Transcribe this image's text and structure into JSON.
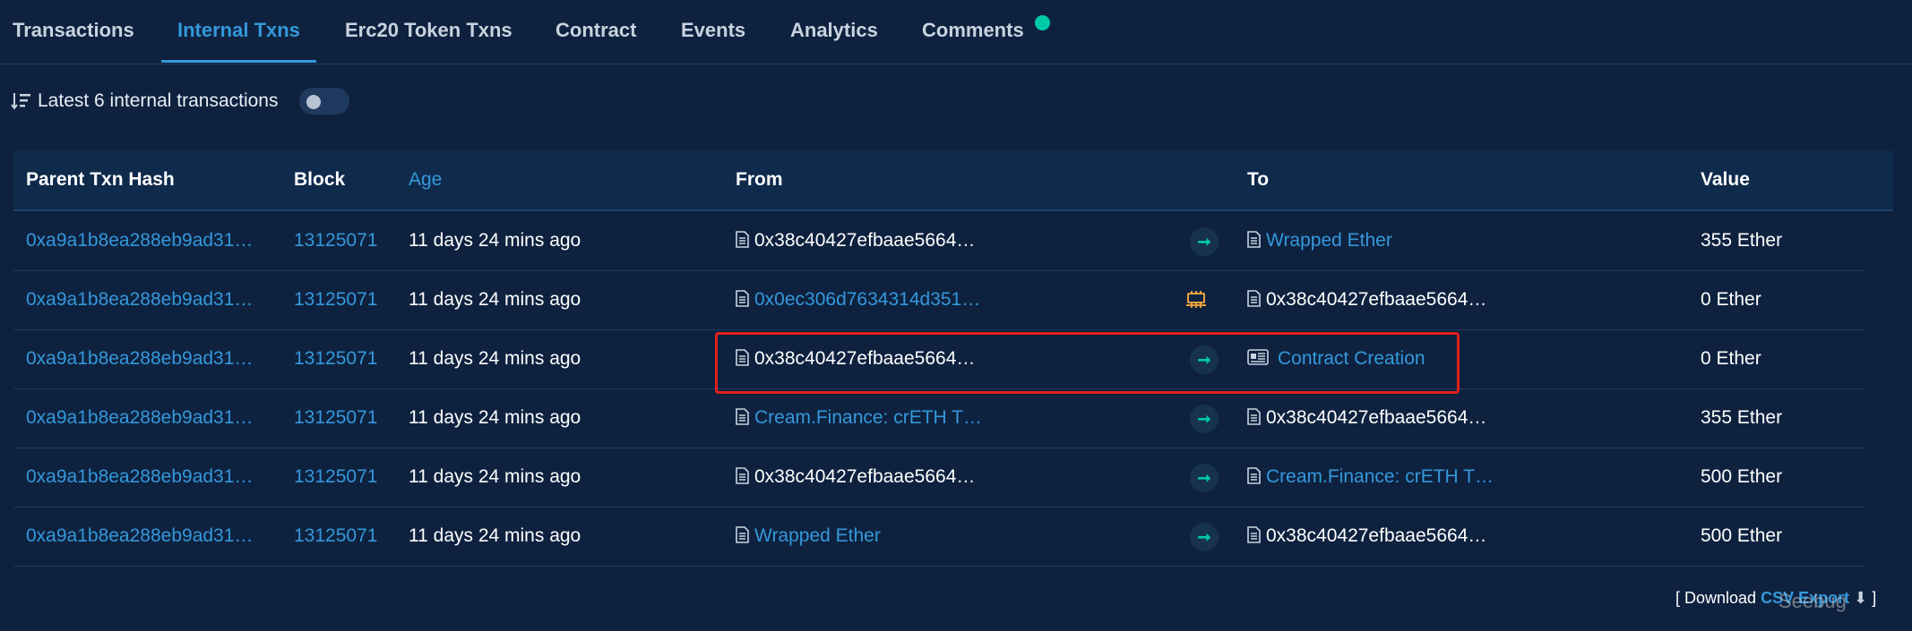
{
  "tabs": {
    "transactions": "Transactions",
    "internal": "Internal Txns",
    "erc20": "Erc20 Token Txns",
    "contract": "Contract",
    "events": "Events",
    "analytics": "Analytics",
    "comments": "Comments"
  },
  "summary": {
    "text": "Latest 6 internal transactions"
  },
  "table": {
    "headers": {
      "hash": "Parent Txn Hash",
      "block": "Block",
      "age": "Age",
      "from": "From",
      "to": "To",
      "value": "Value"
    },
    "rows": [
      {
        "hash": "0xa9a1b8ea288eb9ad31…",
        "block": "13125071",
        "age": "11 days 24 mins ago",
        "from": "0x38c40427efbaae5664…",
        "direction": "arrow",
        "to": "Wrapped Ether",
        "value": "355 Ether"
      },
      {
        "hash": "0xa9a1b8ea288eb9ad31…",
        "block": "13125071",
        "age": "11 days 24 mins ago",
        "from": "0x0ec306d7634314d351…",
        "direction": "chip",
        "to": "0x38c40427efbaae5664…",
        "value": "0 Ether"
      },
      {
        "hash": "0xa9a1b8ea288eb9ad31…",
        "block": "13125071",
        "age": "11 days 24 mins ago",
        "from": "0x38c40427efbaae5664…",
        "direction": "arrow",
        "to": "Contract Creation",
        "value": "0 Ether"
      },
      {
        "hash": "0xa9a1b8ea288eb9ad31…",
        "block": "13125071",
        "age": "11 days 24 mins ago",
        "from": "Cream.Finance: crETH T…",
        "direction": "arrow",
        "to": "0x38c40427efbaae5664…",
        "value": "355 Ether"
      },
      {
        "hash": "0xa9a1b8ea288eb9ad31…",
        "block": "13125071",
        "age": "11 days 24 mins ago",
        "from": "0x38c40427efbaae5664…",
        "direction": "arrow",
        "to": "Cream.Finance: crETH T…",
        "value": "500 Ether"
      },
      {
        "hash": "0xa9a1b8ea288eb9ad31…",
        "block": "13125071",
        "age": "11 days 24 mins ago",
        "from": "Wrapped Ether",
        "direction": "arrow",
        "to": "0x38c40427efbaae5664…",
        "value": "500 Ether"
      }
    ]
  },
  "footer": {
    "prefix": "[ Download",
    "link": "CSV Export",
    "suffix": "]"
  },
  "watermark": "Seebug",
  "icons": {
    "sort": "sort-desc-icon",
    "document": "document-icon",
    "arrow": "arrow-right-icon",
    "chip": "chip-icon",
    "contract_creation": "contract-creation-icon",
    "download": "download-icon"
  },
  "colors": {
    "background": "#0e223f",
    "link": "#3498db",
    "accent": "#00c9a7",
    "chip": "#e8a33d",
    "highlight": "#e0201d"
  }
}
